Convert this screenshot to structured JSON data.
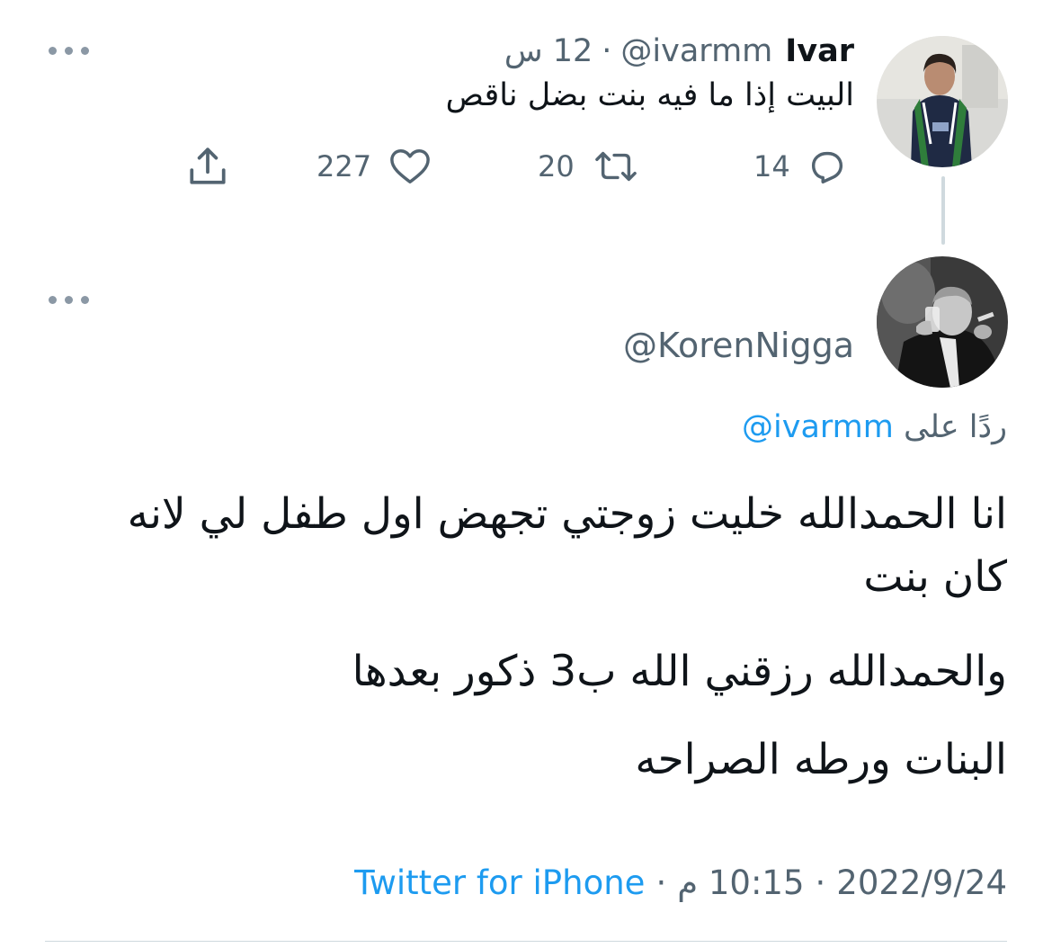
{
  "parent_tweet": {
    "display_name": "Ivar",
    "handle": "@ivarmm",
    "separator": "·",
    "time_ago": "12 س",
    "text": "البيت إذا ما فيه بنت بضل ناقص",
    "reply_count": "14",
    "retweet_count": "20",
    "like_count": "227"
  },
  "main_tweet": {
    "handle": "@KorenNigga",
    "reply_prefix": "ردًا على",
    "reply_to_handle": "@ivarmm",
    "paragraphs": [
      "انا الحمدالله خليت زوجتي تجهض اول طفل لي لانه كان بنت",
      "والحمدالله رزقني الله ب3 ذكور بعدها",
      "البنات ورطه الصراحه"
    ],
    "date": "2022/9/24",
    "time": "10:15 م",
    "separator": "·",
    "source": "Twitter for iPhone"
  },
  "colors": {
    "text_primary": "#0f1419",
    "text_secondary": "#536471",
    "link": "#1d9bf0",
    "border": "#cfd9de"
  },
  "icons": {
    "more": "more-horizontal-icon",
    "reply": "reply-bubble-icon",
    "retweet": "retweet-icon",
    "like": "heart-icon",
    "share": "share-icon"
  }
}
